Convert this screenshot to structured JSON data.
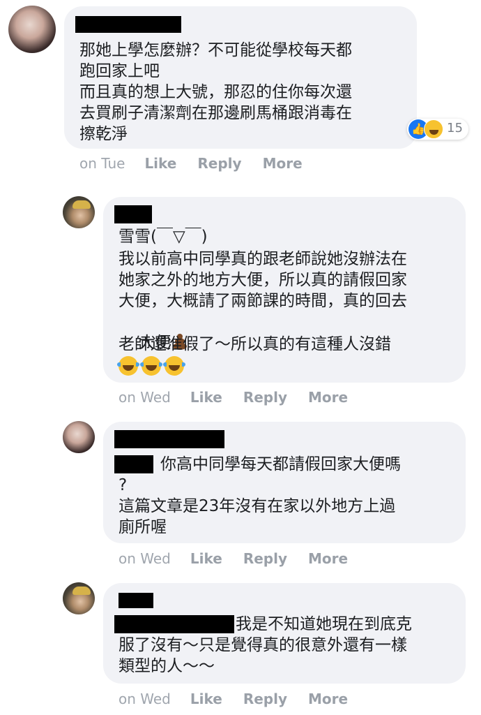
{
  "comments": [
    {
      "lines": [
        "那她上學怎麼辦？不可能從學校每天都",
        "跑回家上吧",
        "而且真的想上大號，那忍的住你每次還",
        "去買刷子清潔劑在那邊刷馬桶跟消毒在",
        "擦乾淨"
      ],
      "reaction_count": "15",
      "time": "on Tue"
    },
    {
      "lines": [
        "雪雪(￣▽￣)",
        "我以前高中同學真的跟老師說她沒辦法在",
        "她家之外的地方大便，所以真的請假回家",
        "大便，大概請了兩節課的時間，真的回去",
        "大便",
        "老師還准假了～所以真的有這種人沒錯"
      ],
      "time": "on Wed"
    },
    {
      "lines": [
        "你高中同學每天都請假回家大便嗎",
        "?",
        "這篇文章是23年沒有在家以外地方上過",
        "廁所喔"
      ],
      "time": "on Wed"
    },
    {
      "lines": [
        "我是不知道她現在到底克",
        "服了沒有～只是覺得真的很意外還有一樣",
        "類型的人～～"
      ],
      "time": "on Wed"
    }
  ],
  "actions": {
    "like": "Like",
    "reply": "Reply",
    "more": "More"
  },
  "icons": [
    "like-reaction-icon",
    "haha-reaction-icon",
    "poop-emoji",
    "tears-of-joy-emoji"
  ],
  "colors": {
    "bubble": "#f1f2f6",
    "meta": "#8d949e",
    "like_blue": "#1877f2"
  }
}
